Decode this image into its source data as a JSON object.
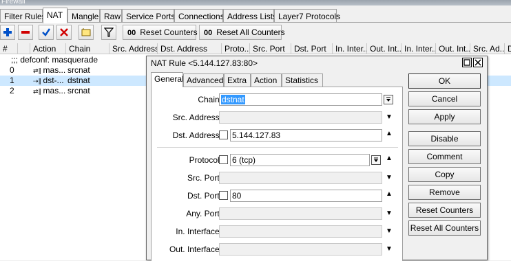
{
  "window": {
    "title": "Firewall"
  },
  "tabs": [
    "Filter Rules",
    "NAT",
    "Mangle",
    "Raw",
    "Service Ports",
    "Connections",
    "Address Lists",
    "Layer7 Protocols"
  ],
  "active_tab": "NAT",
  "toolbar": {
    "reset_counters": "Reset Counters",
    "reset_all_counters": "Reset All Counters",
    "oo": "00"
  },
  "table": {
    "columns": [
      "#",
      "",
      "Action",
      "Chain",
      "Src. Address",
      "Dst. Address",
      "Proto...",
      "Src. Port",
      "Dst. Port",
      "In. Inter...",
      "Out. Int...",
      "In. Inter...",
      "Out. Int...",
      "Src. Ad...",
      "D"
    ],
    "comment": ";;; defconf: masquerade",
    "rows": [
      {
        "num": "0",
        "action": "mas...",
        "chain": "srcnat"
      },
      {
        "num": "1",
        "action": "dst-...",
        "chain": "dstnat"
      },
      {
        "num": "2",
        "action": "mas...",
        "chain": "srcnat"
      }
    ]
  },
  "dialog": {
    "title": "NAT Rule <5.144.127.83:80>",
    "tabs": [
      "General",
      "Advanced",
      "Extra",
      "Action",
      "Statistics"
    ],
    "fields": {
      "chain": {
        "label": "Chain:",
        "value": "dstnat"
      },
      "src_address": {
        "label": "Src. Address:",
        "value": ""
      },
      "dst_address": {
        "label": "Dst. Address:",
        "value": "5.144.127.83"
      },
      "protocol": {
        "label": "Protocol:",
        "value": "6 (tcp)"
      },
      "src_port": {
        "label": "Src. Port:",
        "value": ""
      },
      "dst_port": {
        "label": "Dst. Port:",
        "value": "80"
      },
      "any_port": {
        "label": "Any. Port:",
        "value": ""
      },
      "in_interface": {
        "label": "In. Interface:",
        "value": ""
      },
      "out_interface": {
        "label": "Out. Interface:",
        "value": ""
      }
    },
    "buttons": {
      "ok": "OK",
      "cancel": "Cancel",
      "apply": "Apply",
      "disable": "Disable",
      "comment": "Comment",
      "copy": "Copy",
      "remove": "Remove",
      "reset_counters": "Reset Counters",
      "reset_all_counters": "Reset All Counters"
    }
  },
  "colors": {
    "selected_row": "#cde8ff",
    "add": "#0050c8",
    "remove": "#d00000"
  }
}
